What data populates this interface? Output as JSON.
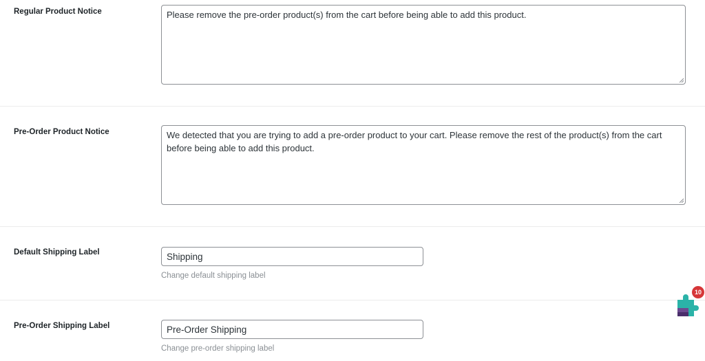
{
  "settings": {
    "regular_product_notice": {
      "label": "Regular Product Notice",
      "value": "Please remove the pre-order product(s) from the cart before being able to add this product."
    },
    "pre_order_product_notice": {
      "label": "Pre-Order Product Notice",
      "value": "We detected that you are trying to add a pre-order product to your cart. Please remove the rest of the product(s) from the cart before being able to add this product."
    },
    "default_shipping_label": {
      "label": "Default Shipping Label",
      "value": "Shipping",
      "description": "Change default shipping label"
    },
    "pre_order_shipping_label": {
      "label": "Pre-Order Shipping Label",
      "value": "Pre-Order Shipping",
      "description": "Change pre-order shipping label"
    }
  },
  "plugin_widget": {
    "icon": "puzzle-piece-icon",
    "badge_count": "10",
    "badge_color": "#d63638",
    "colors": [
      "#2bb3a8",
      "#6c4a8f",
      "#4a2e6b"
    ]
  },
  "colors": {
    "border": "#8c8f94",
    "divider": "#ececec",
    "description_text": "#8a8f94",
    "label_text": "#1d2327"
  }
}
